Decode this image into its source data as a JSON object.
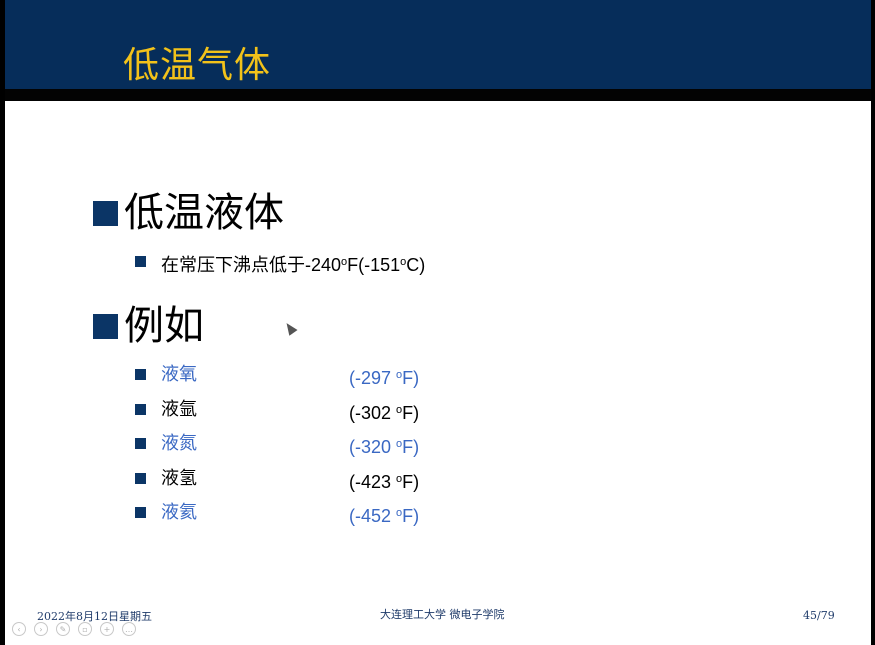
{
  "slide": {
    "title": "低温气体",
    "section1": {
      "heading": "低温液体",
      "bullet_pre": "在常压下沸点低于-240",
      "bullet_sup1": "o",
      "bullet_mid": "F(-151",
      "bullet_sup2": "o",
      "bullet_post": "C)"
    },
    "section2": {
      "heading": "例如",
      "items": [
        {
          "name": "液氧",
          "temp_pre": "(-297 ",
          "sup": "o",
          "temp_post": "F)",
          "color": "#3a68c3"
        },
        {
          "name": "液氩",
          "temp_pre": "(-302 ",
          "sup": "o",
          "temp_post": "F)",
          "color": "#000000"
        },
        {
          "name": "液氮",
          "temp_pre": "(-320 ",
          "sup": "o",
          "temp_post": "F)",
          "color": "#3a68c3"
        },
        {
          "name": "液氢",
          "temp_pre": "(-423 ",
          "sup": "o",
          "temp_post": "F)",
          "color": "#000000"
        },
        {
          "name": "液氦",
          "temp_pre": "(-452 ",
          "sup": "o",
          "temp_post": "F)",
          "color": "#3a68c3"
        }
      ]
    },
    "footer": {
      "date": "2022年8月12日星期五",
      "center": "大连理工大学  微电子学院",
      "page": "45/79"
    }
  },
  "colors": {
    "header_bg": "#062d5a",
    "title": "#f2c21a",
    "bullet": "#0b3566",
    "accent_text": "#3a68c3"
  },
  "controls": [
    {
      "icon": "previous-icon",
      "glyph": "‹"
    },
    {
      "icon": "next-icon",
      "glyph": "›"
    },
    {
      "icon": "pen-icon",
      "glyph": "✎"
    },
    {
      "icon": "slides-icon",
      "glyph": "▫"
    },
    {
      "icon": "zoom-icon",
      "glyph": "+"
    },
    {
      "icon": "more-icon",
      "glyph": "…"
    }
  ]
}
